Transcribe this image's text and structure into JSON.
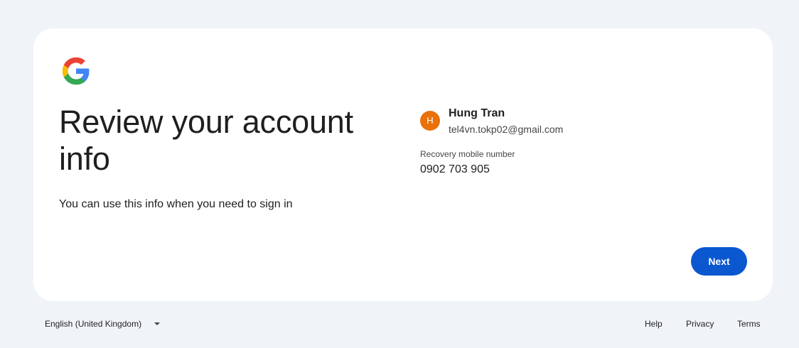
{
  "brand": {
    "logo": "google-g-icon"
  },
  "main": {
    "headline": "Review your account info",
    "subtext": "You can use this info when you need to sign in"
  },
  "account": {
    "avatar_initial": "H",
    "avatar_color": "#e8710a",
    "name": "Hung Tran",
    "email": "tel4vn.tokp02@gmail.com"
  },
  "recovery": {
    "label": "Recovery mobile number",
    "value": "0902 703 905"
  },
  "actions": {
    "next_label": "Next",
    "accent": "#0b57d0"
  },
  "footer": {
    "language": "English (United Kingdom)",
    "links": [
      "Help",
      "Privacy",
      "Terms"
    ]
  }
}
